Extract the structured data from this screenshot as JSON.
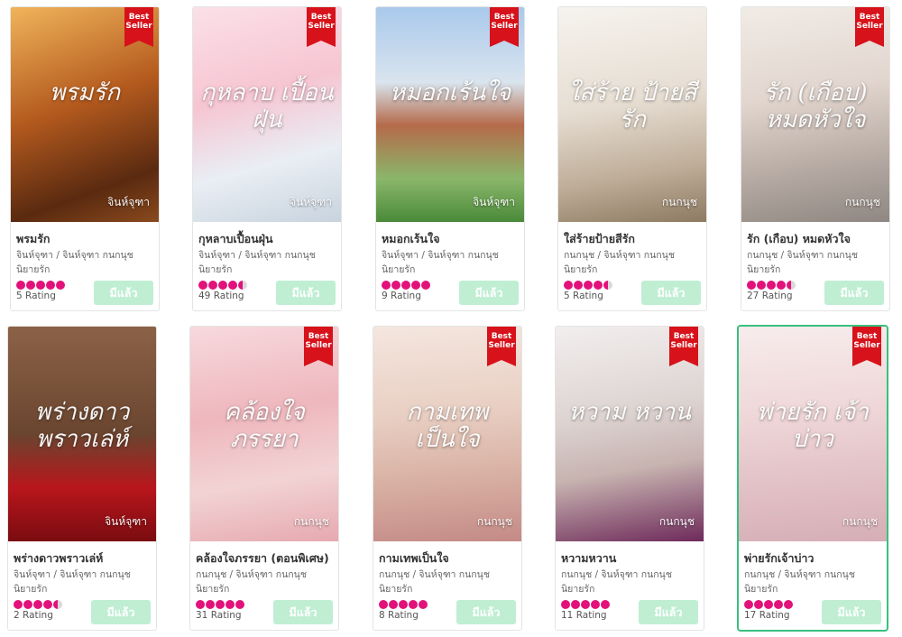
{
  "badge_label_line1": "Best",
  "badge_label_line2": "Seller",
  "owned_label": "มีแล้ว",
  "colors": {
    "star": "#e2127a",
    "owned_button": "#bfeed3",
    "ribbon": "#d7121a",
    "selected_border": "#39c07f"
  },
  "books": [
    {
      "title": "พรมรัก",
      "cover_title": "พรมรัก",
      "cover_author": "จินห์จุฑา",
      "authors": "จินห์จุฑา / จินห์จุฑา กนกนุช",
      "category": "นิยายรัก",
      "rating_count": "5 Rating",
      "stars": 5,
      "best_seller": true,
      "cover_gradient": "linear-gradient(160deg,#f0b45a 0%,#b45a1e 45%,#5a2a10 80%,#8a4a1e 100%)"
    },
    {
      "title": "กุหลาบเปื้อนฝุ่น",
      "cover_title": "กุหลาบ เปื้อนฝุ่น",
      "cover_author": "จินห์จุฑา",
      "authors": "จินห์จุฑา / จินห์จุฑา กนกนุช",
      "category": "นิยายรัก",
      "rating_count": "49 Rating",
      "stars": 4.5,
      "best_seller": true,
      "cover_gradient": "linear-gradient(165deg,#fbe0e8 0%,#f6c5d2 40%,#e9eef4 70%,#c8d3de 100%)"
    },
    {
      "title": "หมอกเร้นใจ",
      "cover_title": "หมอกเร้นใจ",
      "cover_author": "จินห์จุฑา",
      "authors": "จินห์จุฑา / จินห์จุฑา กนกนุช",
      "category": "นิยายรัก",
      "rating_count": "9 Rating",
      "stars": 5,
      "best_seller": true,
      "cover_gradient": "linear-gradient(180deg,#a9c9ec 0%,#d9e4ee 35%,#b56a4a 55%,#8ab66a 80%,#4a8a3a 100%)"
    },
    {
      "title": "ใส่ร้ายป้ายสีรัก",
      "cover_title": "ใส่ร้าย ป้ายสีรัก",
      "cover_author": "กนกนุช",
      "authors": "กนกนุช / จินห์จุฑา กนกนุช",
      "category": "นิยายรัก",
      "rating_count": "5 Rating",
      "stars": 4.5,
      "best_seller": false,
      "cover_gradient": "linear-gradient(170deg,#f6f3ee 0%,#e6ddd2 45%,#bfae99 75%,#8d7a62 100%)"
    },
    {
      "title": "รัก (เกือบ) หมดหัวใจ",
      "cover_title": "รัก (เกือบ) หมดหัวใจ",
      "cover_author": "กนกนุช",
      "authors": "กนกนุช / จินห์จุฑา กนกนุช",
      "category": "นิยายรัก",
      "rating_count": "27 Rating",
      "stars": 4.5,
      "best_seller": true,
      "cover_gradient": "linear-gradient(170deg,#f1ebe6 0%,#e2d6cf 40%,#b9ada6 70%,#8f8782 100%)"
    },
    {
      "title": "พร่างดาวพราวเล่ห์",
      "cover_title": "พร่างดาว พราวเล่ห์",
      "cover_author": "จินห์จุฑา",
      "authors": "จินห์จุฑา / จินห์จุฑา กนกนุช",
      "category": "นิยายรัก",
      "rating_count": "2 Rating",
      "stars": 4.5,
      "best_seller": false,
      "cover_gradient": "linear-gradient(180deg,#8c6247 0%,#6a452f 50%,#b8161c 75%,#7a0c10 100%)"
    },
    {
      "title": "คล้องใจภรรยา (ตอนพิเศษ)",
      "cover_title": "คล้องใจ ภรรยา",
      "cover_author": "กนกนุช",
      "authors": "กนกนุช / จินห์จุฑา กนกนุช",
      "category": "นิยายรัก",
      "rating_count": "31 Rating",
      "stars": 5,
      "best_seller": true,
      "cover_gradient": "linear-gradient(170deg,#f7d9dd 0%,#eeb7bd 40%,#f2d3d4 70%,#e6a9b0 100%)"
    },
    {
      "title": "กามเทพเป็นใจ",
      "cover_title": "กามเทพ เป็นใจ",
      "cover_author": "กนกนุช",
      "authors": "กนกนุช / จินห์จุฑา กนกนุช",
      "category": "นิยายรัก",
      "rating_count": "8 Rating",
      "stars": 5,
      "best_seller": true,
      "cover_gradient": "linear-gradient(175deg,#f4e6df 0%,#e9cfc3 40%,#d8b0a3 70%,#c48a86 100%)"
    },
    {
      "title": "หวามหวาน",
      "cover_title": "หวาม หวาน",
      "cover_author": "กนกนุช",
      "authors": "กนกนุช / จินห์จุฑา กนกนุช",
      "category": "นิยายรัก",
      "rating_count": "11 Rating",
      "stars": 5,
      "best_seller": true,
      "cover_gradient": "linear-gradient(170deg,#f2eeee 0%,#ddd4d2 40%,#c7b3b0 65%,#6e2a5a 100%)"
    },
    {
      "title": "พ่ายรักเจ้าบ่าว",
      "cover_title": "พ่ายรัก เจ้าบ่าว",
      "cover_author": "กนกนุช",
      "authors": "กนกนุช / จินห์จุฑา กนกนุช",
      "category": "นิยายรัก",
      "rating_count": "17 Rating",
      "stars": 5,
      "best_seller": true,
      "cover_gradient": "linear-gradient(175deg,#f7ecec 0%,#efd7d8 40%,#e2c2c7 70%,#d6aeb6 100%)"
    }
  ]
}
